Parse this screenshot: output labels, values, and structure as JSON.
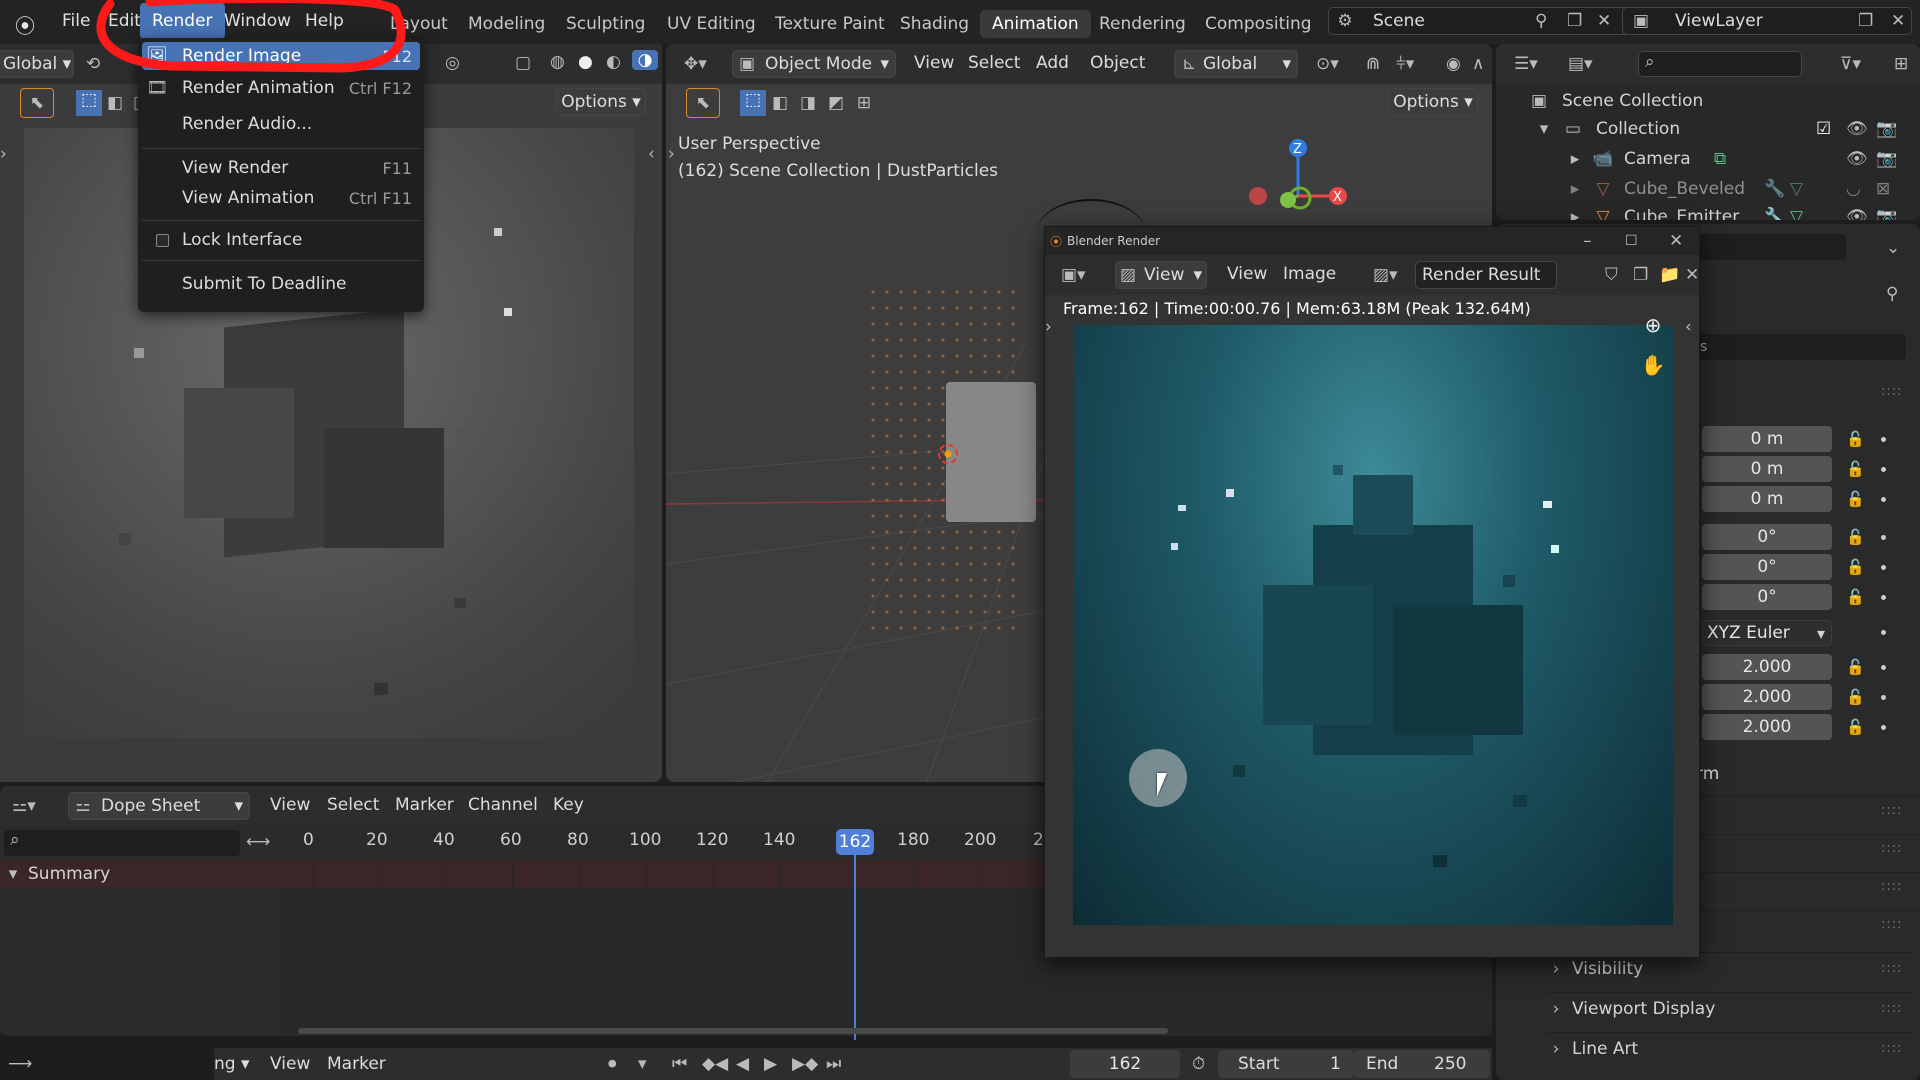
{
  "topbar": {
    "menus": [
      "File",
      "Edit",
      "Render",
      "Window",
      "Help"
    ],
    "workspaces": [
      "Layout",
      "Modeling",
      "Sculpting",
      "UV Editing",
      "Texture Paint",
      "Shading",
      "Animation",
      "Rendering",
      "Compositing"
    ],
    "active_workspace": "Animation",
    "scene": "Scene",
    "view_layer": "ViewLayer"
  },
  "render_menu": {
    "items": [
      {
        "label": "Render Image",
        "shortcut": "F12"
      },
      {
        "label": "Render Animation",
        "shortcut": "Ctrl F12"
      },
      {
        "label": "Render Audio...",
        "shortcut": ""
      },
      {
        "label": "View Render",
        "shortcut": "F11"
      },
      {
        "label": "View Animation",
        "shortcut": "Ctrl F11"
      },
      {
        "label": "Lock Interface",
        "shortcut": ""
      },
      {
        "label": "Submit To Deadline",
        "shortcut": ""
      }
    ]
  },
  "left_viewport": {
    "transform": "Global",
    "options": "Options"
  },
  "center_viewport": {
    "mode": "Object Mode",
    "menus": [
      "View",
      "Select",
      "Add",
      "Object"
    ],
    "transform": "Global",
    "options": "Options",
    "perspective": "User Perspective",
    "collection_info": "(162) Scene Collection | DustParticles"
  },
  "outliner": {
    "root": "Scene Collection",
    "collection": "Collection",
    "items": [
      "Camera",
      "Cube_Beveled",
      "Cube_Emitter"
    ]
  },
  "properties": {
    "location": [
      "0 m",
      "0 m",
      "0 m"
    ],
    "rotation": [
      "0°",
      "0°",
      "0°"
    ],
    "rotation_mode": "XYZ Euler",
    "scale": [
      "2.000",
      "2.000",
      "2.000"
    ],
    "partial_label": "rm",
    "sections": [
      "Visibility",
      "Viewport Display",
      "Line Art"
    ]
  },
  "render_window": {
    "title": "Blender Render",
    "menus": [
      "View",
      "View",
      "Image"
    ],
    "slot": "Render Result",
    "stats": "Frame:162 | Time:00:00.76 | Mem:63.18M (Peak 132.64M)"
  },
  "dopesheet": {
    "editor": "Dope Sheet",
    "menus": [
      "View",
      "Select",
      "Marker",
      "Channel",
      "Key"
    ],
    "summary": "Summary",
    "ticks": [
      "0",
      "20",
      "40",
      "60",
      "80",
      "100",
      "120",
      "140",
      "180",
      "200",
      "2"
    ],
    "current_frame": "162"
  },
  "timeline": {
    "mode_partial": "ng",
    "menus": [
      "View",
      "Marker"
    ],
    "frame": "162",
    "start_label": "Start",
    "start": "1",
    "end_label": "End",
    "end": "250"
  },
  "colors": {
    "accent": "#4772b3",
    "annotation": "#ff1a1a",
    "playhead": "#4f7fd6"
  }
}
